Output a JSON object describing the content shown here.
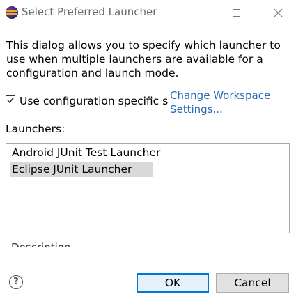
{
  "window": {
    "title": "Select Preferred Launcher",
    "icon": "eclipse-icon"
  },
  "description": "This dialog allows you to specify which launcher to use when multiple launchers are available for a configuration and launch mode.",
  "config_specific": {
    "label": "Use configuration specific settings",
    "checked": true
  },
  "workspace_link": "Change Workspace Settings...",
  "launchers": {
    "label": "Launchers:",
    "items": [
      {
        "label": "Android JUnit Test Launcher",
        "selected": false
      },
      {
        "label": "Eclipse JUnit Launcher",
        "selected": true
      }
    ]
  },
  "description_label": "Description",
  "buttons": {
    "ok": "OK",
    "cancel": "Cancel",
    "help": "?"
  }
}
